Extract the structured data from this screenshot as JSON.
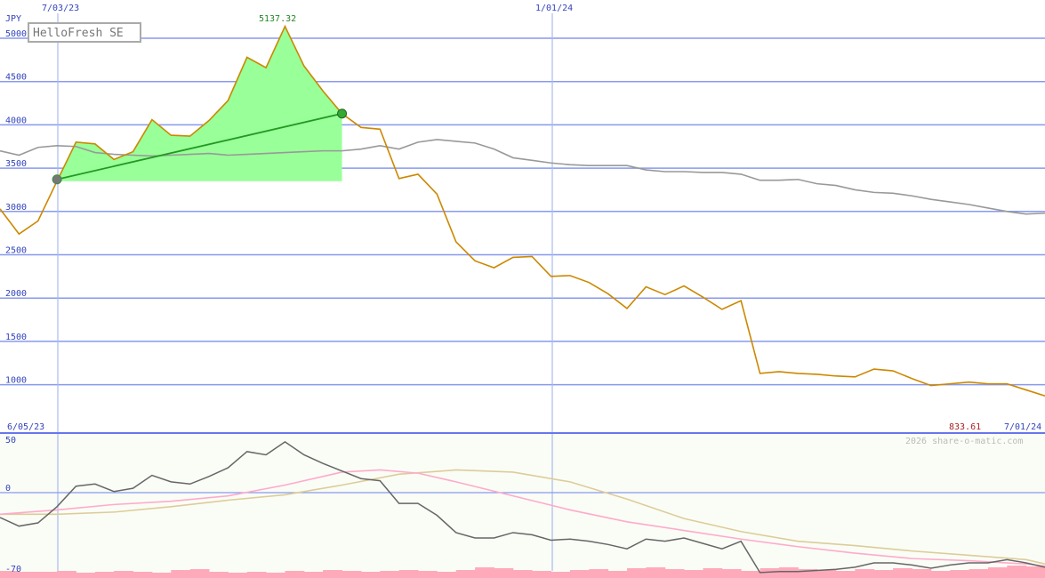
{
  "title": "HelloFresh SE",
  "currency": "JPY",
  "watermark": "2026 share-o-matic.com",
  "colors": {
    "price": "#cc8800",
    "index": "#999999",
    "highlight_fill": "#99ff99",
    "trend": "#229922",
    "osc": "#666666",
    "ma_pink": "#ffaacc",
    "ma_tan": "#ddcc99",
    "volume": "#ffaabb",
    "grid": "#8899ee",
    "axis_label": "#3344bb"
  },
  "chart_data": [
    {
      "type": "line",
      "title": "HelloFresh SE",
      "ylabel": "JPY",
      "ylim": [
        0,
        5450
      ],
      "x_start_label": "6/05/23",
      "x_end_label": "7/01/24",
      "top_date_labels": [
        "7/03/23",
        "1/01/24"
      ],
      "y_ticks": [
        1000,
        1500,
        2000,
        2500,
        3000,
        3500,
        4000,
        4500,
        5000
      ],
      "max_label": "5137.32",
      "last_label": "833.61",
      "grid": true,
      "series": [
        {
          "key": "price",
          "x": [
            0,
            1,
            2,
            3,
            4,
            5,
            6,
            7,
            8,
            9,
            10,
            11,
            12,
            13,
            14,
            15,
            16,
            17,
            18,
            19,
            20,
            21,
            22,
            23,
            24,
            25,
            26,
            27,
            28,
            29,
            30,
            31,
            32,
            33,
            34,
            35,
            36,
            37,
            38,
            39,
            40,
            41,
            42,
            43,
            44,
            45,
            46,
            47,
            48,
            49,
            50,
            51,
            52,
            53,
            54,
            55
          ],
          "values": [
            3030,
            2740,
            2890,
            3350,
            3800,
            3780,
            3600,
            3690,
            4060,
            3880,
            3870,
            4050,
            4280,
            4780,
            4660,
            5137.32,
            4680,
            4390,
            4130,
            3970,
            3950,
            3380,
            3430,
            3200,
            2650,
            2430,
            2350,
            2470,
            2480,
            2250,
            2260,
            2180,
            2050,
            1880,
            2130,
            2040,
            2140,
            2010,
            1870,
            1970,
            1130,
            1150,
            1130,
            1120,
            1100,
            1090,
            1180,
            1160,
            1070,
            990,
            1010,
            1030,
            1010,
            1010,
            940,
            870
          ]
        },
        {
          "key": "index",
          "x": [
            0,
            1,
            2,
            3,
            4,
            5,
            6,
            7,
            8,
            9,
            10,
            11,
            12,
            13,
            14,
            15,
            16,
            17,
            18,
            19,
            20,
            21,
            22,
            23,
            24,
            25,
            26,
            27,
            28,
            29,
            30,
            31,
            32,
            33,
            34,
            35,
            36,
            37,
            38,
            39,
            40,
            41,
            42,
            43,
            44,
            45,
            46,
            47,
            48,
            49,
            50,
            51,
            52,
            53,
            54,
            55
          ],
          "values": [
            3700,
            3650,
            3740,
            3760,
            3750,
            3680,
            3660,
            3650,
            3640,
            3650,
            3660,
            3670,
            3650,
            3660,
            3670,
            3680,
            3690,
            3700,
            3700,
            3720,
            3760,
            3720,
            3800,
            3830,
            3810,
            3790,
            3720,
            3620,
            3590,
            3560,
            3540,
            3530,
            3530,
            3530,
            3480,
            3460,
            3460,
            3450,
            3450,
            3430,
            3360,
            3360,
            3370,
            3320,
            3300,
            3250,
            3220,
            3210,
            3180,
            3140,
            3110,
            3080,
            3040,
            3000,
            2970,
            2980
          ]
        }
      ],
      "highlight": {
        "from_x": 3,
        "to_x": 18,
        "base_value": 3350,
        "trend_start": 3370,
        "trend_end": 4130
      }
    },
    {
      "type": "line",
      "ylim": [
        -70,
        55
      ],
      "y_ticks": [
        50,
        0,
        -70
      ],
      "series": [
        {
          "key": "oscillator",
          "x": [
            0,
            1,
            2,
            3,
            4,
            5,
            6,
            7,
            8,
            9,
            10,
            11,
            12,
            13,
            14,
            15,
            16,
            17,
            18,
            19,
            20,
            21,
            22,
            23,
            24,
            25,
            26,
            27,
            28,
            29,
            30,
            31,
            32,
            33,
            34,
            35,
            36,
            37,
            38,
            39,
            40,
            41,
            42,
            43,
            44,
            45,
            46,
            47,
            48,
            49,
            50,
            51,
            52,
            53,
            54,
            55
          ],
          "values": [
            -23,
            -31,
            -28,
            -13,
            6,
            8,
            1,
            4,
            16,
            10,
            8,
            15,
            23,
            38,
            35,
            47,
            35,
            27,
            20,
            13,
            11,
            -10,
            -10,
            -21,
            -37,
            -42,
            -42,
            -37,
            -39,
            -44,
            -43,
            -45,
            -48,
            -52,
            -43,
            -45,
            -42,
            -47,
            -52,
            -45,
            -74,
            -73,
            -73,
            -72,
            -71,
            -69,
            -65,
            -65,
            -67,
            -70,
            -67,
            -65,
            -65,
            -62,
            -65,
            -69
          ]
        },
        {
          "key": "ma_pink",
          "x": [
            0,
            3,
            6,
            9,
            12,
            15,
            18,
            20,
            22,
            24,
            27,
            30,
            33,
            36,
            39,
            42,
            45,
            48,
            51,
            54,
            55
          ],
          "values": [
            -20,
            -16,
            -11,
            -8,
            -3,
            7,
            19,
            21,
            18,
            10,
            -3,
            -16,
            -27,
            -35,
            -43,
            -50,
            -56,
            -61,
            -63,
            -66,
            -68
          ]
        },
        {
          "key": "ma_tan",
          "x": [
            0,
            3,
            6,
            9,
            12,
            15,
            18,
            21,
            24,
            27,
            30,
            33,
            36,
            39,
            42,
            45,
            48,
            51,
            54,
            55
          ],
          "values": [
            -20,
            -20,
            -18,
            -13,
            -7,
            -2,
            7,
            17,
            21,
            19,
            10,
            -6,
            -24,
            -36,
            -45,
            -49,
            -54,
            -58,
            -62,
            -66
          ]
        }
      ]
    }
  ]
}
